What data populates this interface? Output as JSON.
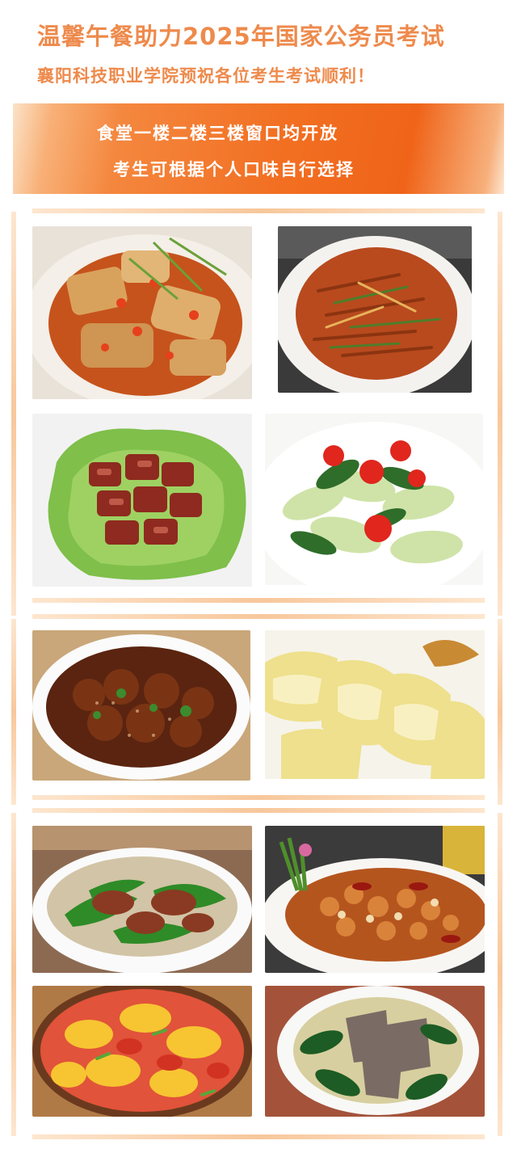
{
  "header": {
    "title": "温馨午餐助力2025年国家公务员考试",
    "subtitle": "襄阳科技职业学院预祝各位考生考试顺利！"
  },
  "banner": {
    "line1": "食堂一楼二楼三楼窗口均开放",
    "line2": "考生可根据个人口味自行选择"
  },
  "colors": {
    "title": "#ee8a4c",
    "banner": "#f26f22",
    "frame": "#f8c79b"
  },
  "dishes": [
    {
      "icon": "braised-fish-photo"
    },
    {
      "icon": "shredded-pork-photo"
    },
    {
      "icon": "braised-pork-lettuce-photo"
    },
    {
      "icon": "bok-choy-chili-photo"
    },
    {
      "icon": "sweet-sour-ribs-photo"
    },
    {
      "icon": "white-cut-chicken-photo"
    },
    {
      "icon": "pepper-pork-stirfry-photo"
    },
    {
      "icon": "kung-pao-chicken-photo"
    },
    {
      "icon": "tomato-egg-photo"
    },
    {
      "icon": "pork-liver-soup-photo"
    }
  ]
}
